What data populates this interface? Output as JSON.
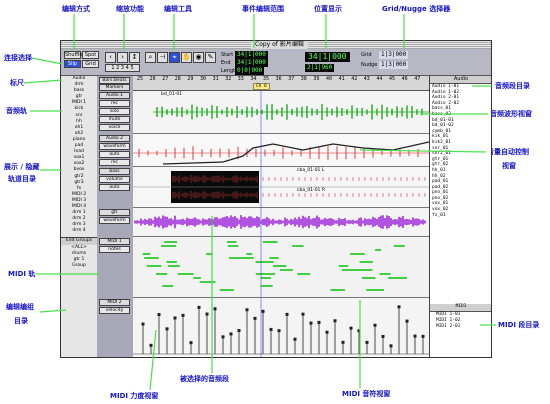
{
  "window": {
    "title": "Copy of 影片编辑"
  },
  "annotations": {
    "edit_mode": "编辑方式",
    "zoom": "缩放功能",
    "edit_tools": "编辑工具",
    "event_range": "事件编辑范围",
    "position": "位置显示",
    "grid_nudge": "Grid/Nugge 选择器",
    "link_select": "连接选择",
    "ruler": "标尺",
    "audio_track": "音频轨",
    "show_hide_1": "展示 / 隐藏",
    "show_hide_2": "轨道目录",
    "midi_track": "MIDI 轨",
    "edit_group_1": "编辑编组",
    "edit_group_2": "目录",
    "midi_velocity": "MIDI 力度视窗",
    "selected_region": "被选择的音频段",
    "midi_note": "MIDI 音符视窗",
    "audio_regions": "音频段目录",
    "waveform_view": "音频波形视窗",
    "volume_automation_1": "音量自动控制",
    "volume_automation_2": "视窗",
    "midi_regions": "MIDI 段目录"
  },
  "toolbar": {
    "mode_buttons": [
      "Shuffle",
      "Spot",
      "Slip",
      "Grid"
    ],
    "counter_main": "34|1|000",
    "counter_start": "34|1|000",
    "counter_end": "34|1|000",
    "counter_len": "0|0|000",
    "labels": {
      "start": "Start",
      "end": "End",
      "length": "Length"
    },
    "cursor": "2|1|960",
    "nudge": "1|3|000",
    "grid_label": "Grid",
    "nudge_label": "Nudge"
  },
  "ruler": {
    "header_left": "Bars:Beats",
    "header_sub": "Markers",
    "bars": [
      "25",
      "26",
      "27",
      "28",
      "29",
      "30",
      "31",
      "32",
      "33",
      "34",
      "35",
      "36",
      "37",
      "38",
      "39",
      "40",
      "41",
      "42",
      "43",
      "44",
      "45",
      "46",
      "47"
    ],
    "marker": "Ch 6"
  },
  "show_hide_list": [
    "Audio",
    "drm",
    "bass",
    "gtr",
    "MIDI 1",
    "kick",
    "snr",
    "hh",
    "oh1",
    "oh2",
    "piano",
    "pad",
    "lead",
    "vox1",
    "vox2",
    "bvox",
    "gtr2",
    "gtr3",
    "fx",
    "MIDI 2",
    "MIDI 3",
    "MIDI 4",
    "drm 1",
    "drm 2",
    "drm 3",
    "drm 4"
  ],
  "edit_groups": {
    "title": "Edit Groups",
    "items": [
      "<ALL>",
      "drums",
      "gtr 1",
      "Group"
    ]
  },
  "tracks": [
    {
      "name": "Audio 1",
      "buttons": [
        "rec",
        "solo",
        "mute",
        "voice"
      ]
    },
    {
      "name": "Audio 2",
      "buttons": [
        "waveform",
        "auto",
        "rec"
      ]
    },
    {
      "name": "bass",
      "buttons": [
        "volume",
        "auto"
      ]
    },
    {
      "name": "gtr",
      "buttons": [
        "waveform"
      ]
    },
    {
      "name": "MIDI 1",
      "buttons": [
        "notes"
      ]
    },
    {
      "name": "MIDI 2",
      "buttons": [
        "velocity"
      ]
    }
  ],
  "audio_regions": {
    "header": "Audio",
    "items": [
      "Audio 1-01",
      "Audio 1-02",
      "Audio 2-01",
      "Audio 2-02",
      "bass_01",
      "bass_02",
      "bd_01-01",
      "bd_01-02",
      "cymb_01",
      "kik_01",
      "kik2_01",
      "snr_01",
      "snr2_01",
      "gtr_01",
      "gtr_02",
      "hh_01",
      "hh_02",
      "pad_01",
      "pad_02",
      "pno_01",
      "pno_02",
      "vox_01",
      "vox_02",
      "fx_01"
    ]
  },
  "midi_regions": {
    "header": "MIDI",
    "items": [
      "MIDI 1-01",
      "MIDI 1-02",
      "MIDI 2-01"
    ]
  },
  "region_names": {
    "top": "bd_01-01",
    "sel_a": "cba_01-01 L",
    "sel_b": "cba_01-01 R"
  },
  "colors": {
    "midi_notes": "#3fcf3f",
    "waveform_purple": "#9a1ed8",
    "waveform_green": "#1aa81a",
    "waveform_red": "#d82a2a",
    "selection": "#0a0a0a",
    "annotation": "#1515c8",
    "leader": "#4be04b"
  }
}
